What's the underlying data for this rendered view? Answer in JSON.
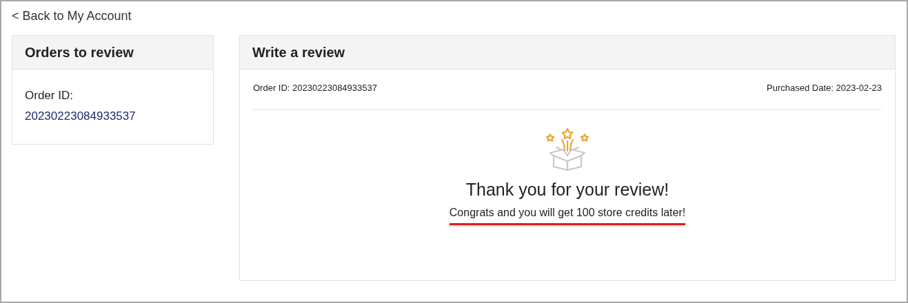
{
  "back_link": {
    "label": "< Back to My Account"
  },
  "orders_panel": {
    "title": "Orders to review",
    "order_label": "Order ID:",
    "order_id": "20230223084933537"
  },
  "review_panel": {
    "title": "Write a review",
    "order_id": "Order ID: 20230223084933537",
    "purchased_date": "Purchased Date: 2023-02-23",
    "message_title": "Thank you for your review!",
    "message_text": "Congrats and you will get 100 store credits later!",
    "underlined": true
  }
}
